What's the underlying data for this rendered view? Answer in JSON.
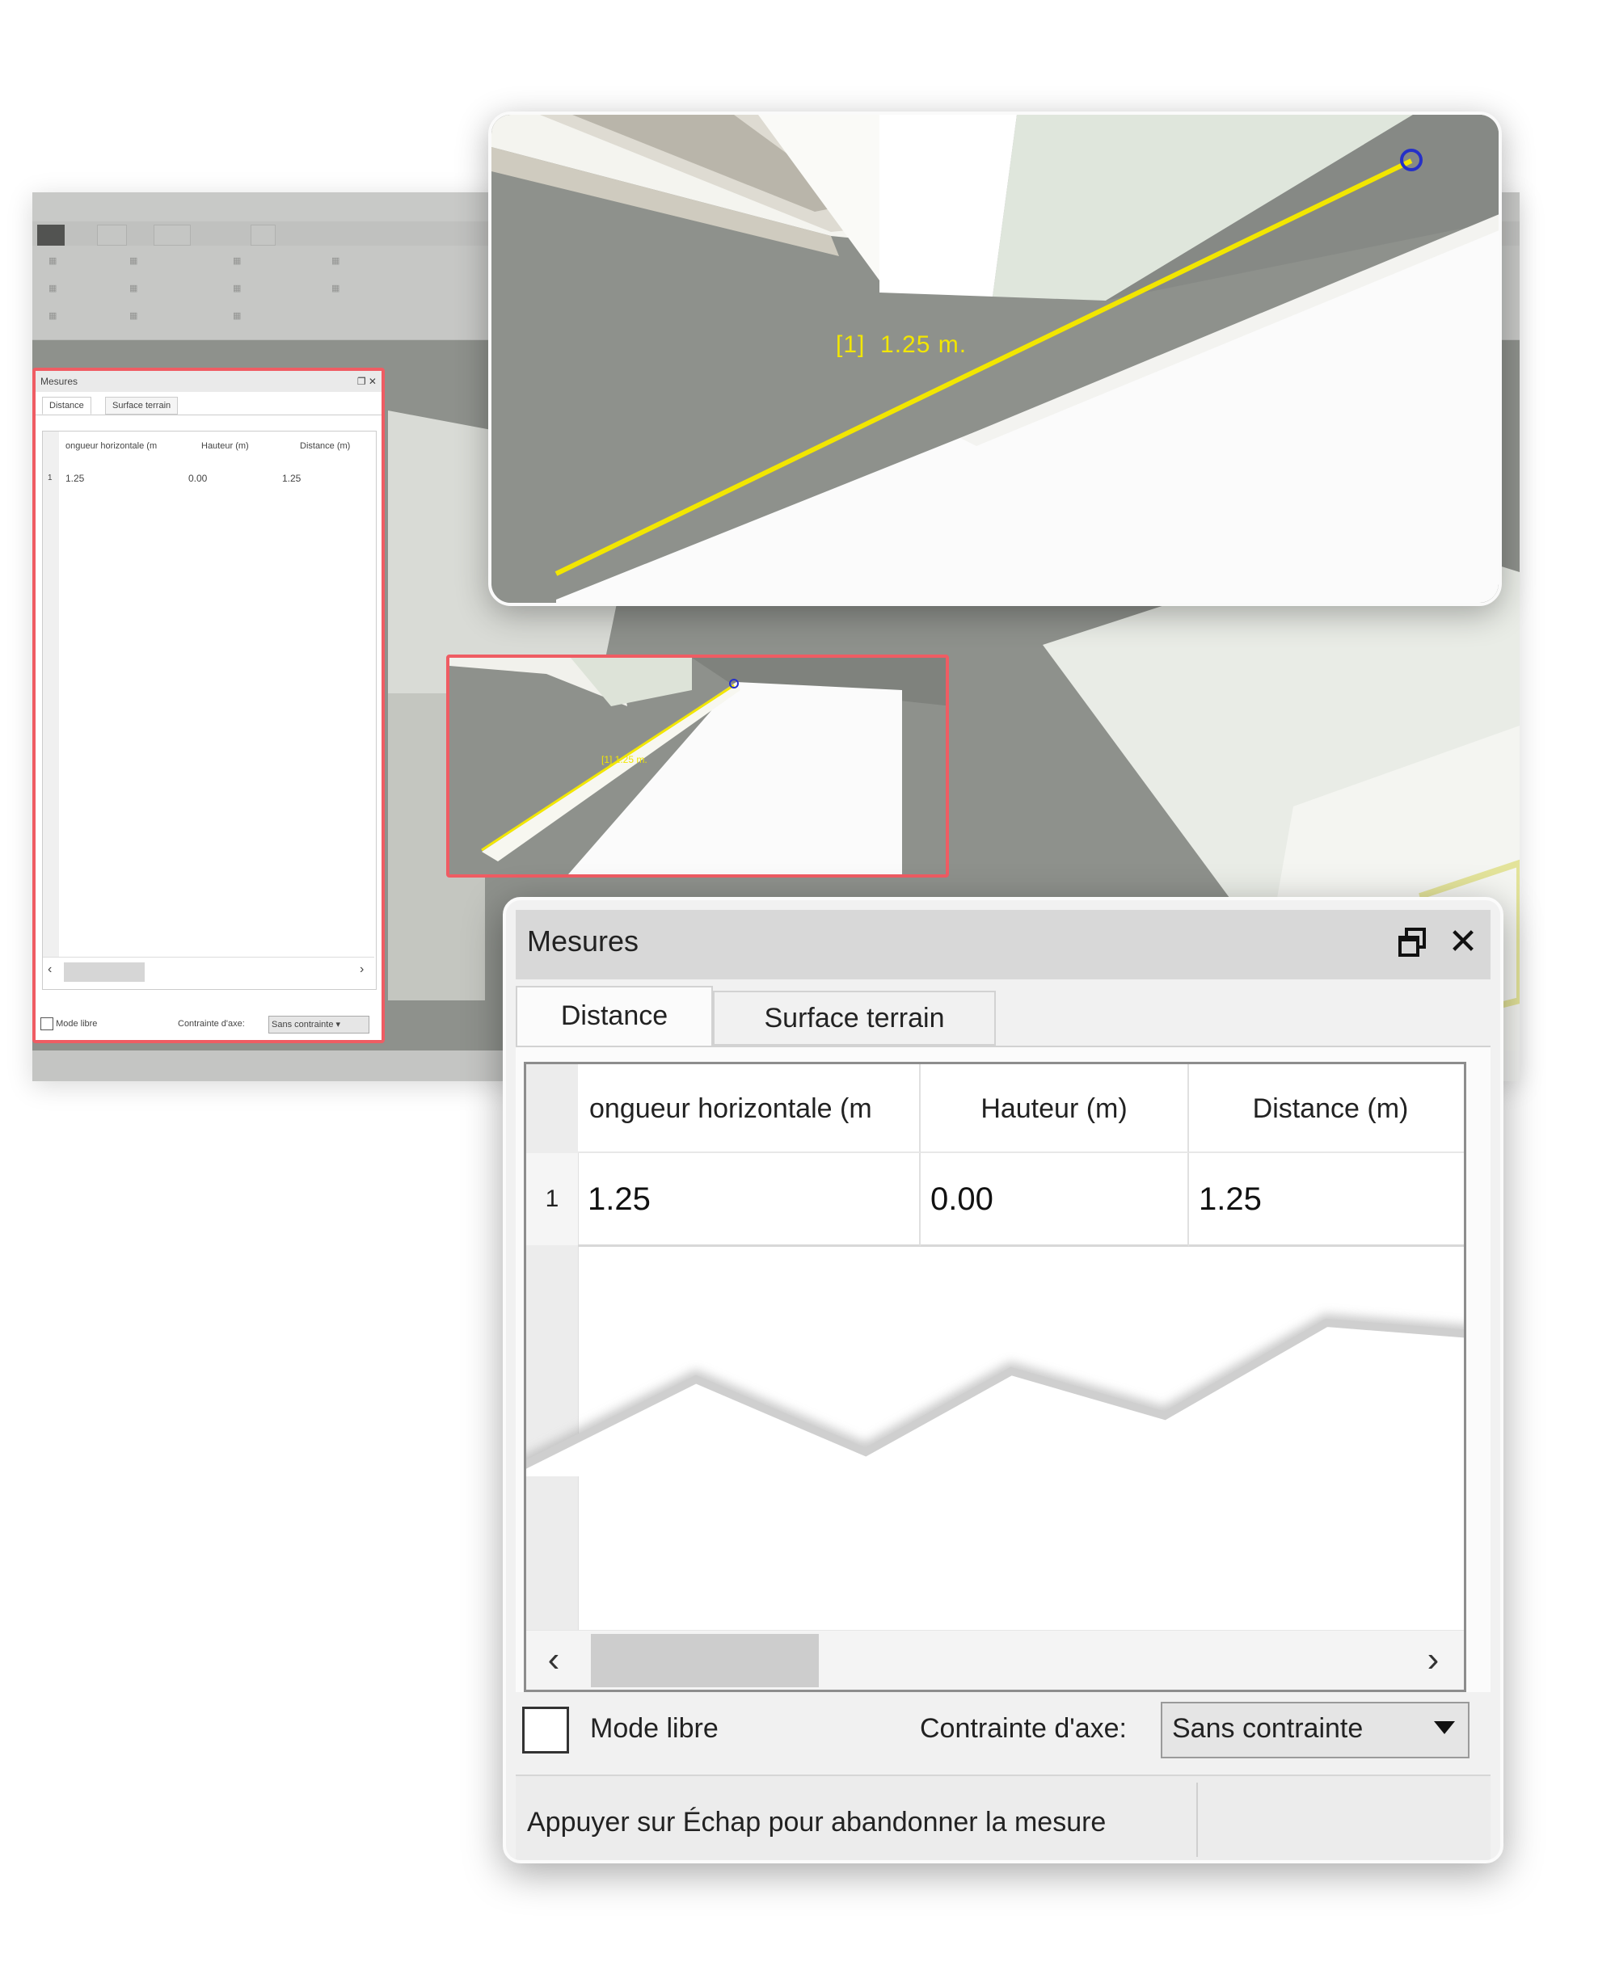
{
  "zoom_view": {
    "measure_label": "[1]  1.25 m."
  },
  "panel": {
    "title": "Mesures",
    "tabs": [
      {
        "label": "Distance",
        "active": true
      },
      {
        "label": "Surface terrain",
        "active": false
      }
    ],
    "table": {
      "columns": [
        "ongueur horizontale (m",
        "Hauteur (m)",
        "Distance (m)"
      ],
      "rows": [
        {
          "index": "1",
          "horizontal": "1.25",
          "height": "0.00",
          "distance": "1.25"
        }
      ]
    },
    "footer": {
      "mode_label": "Mode libre",
      "mode_checked": false,
      "constraint_label": "Contrainte d'axe:",
      "constraint_value": "Sans contrainte"
    },
    "status": "Appuyer sur Échap pour abandonner la mesure"
  },
  "small_panel": {
    "title": "Mesures",
    "tabs": [
      "Distance",
      "Surface terrain"
    ],
    "columns": [
      "ongueur horizontale (m",
      "Hauteur (m)",
      "Distance (m)"
    ],
    "row": [
      "1",
      "1.25",
      "0.00",
      "1.25"
    ],
    "mode_label": "Mode libre",
    "constraint_label": "Contrainte d'axe:",
    "constraint_value": "Sans contrainte"
  },
  "small_view": {
    "measure_label": "[1]  1.25 m."
  },
  "colors": {
    "measure_line": "#f2e600",
    "highlight_border": "#ef5c63",
    "endpoint_marker": "#2530c8"
  }
}
